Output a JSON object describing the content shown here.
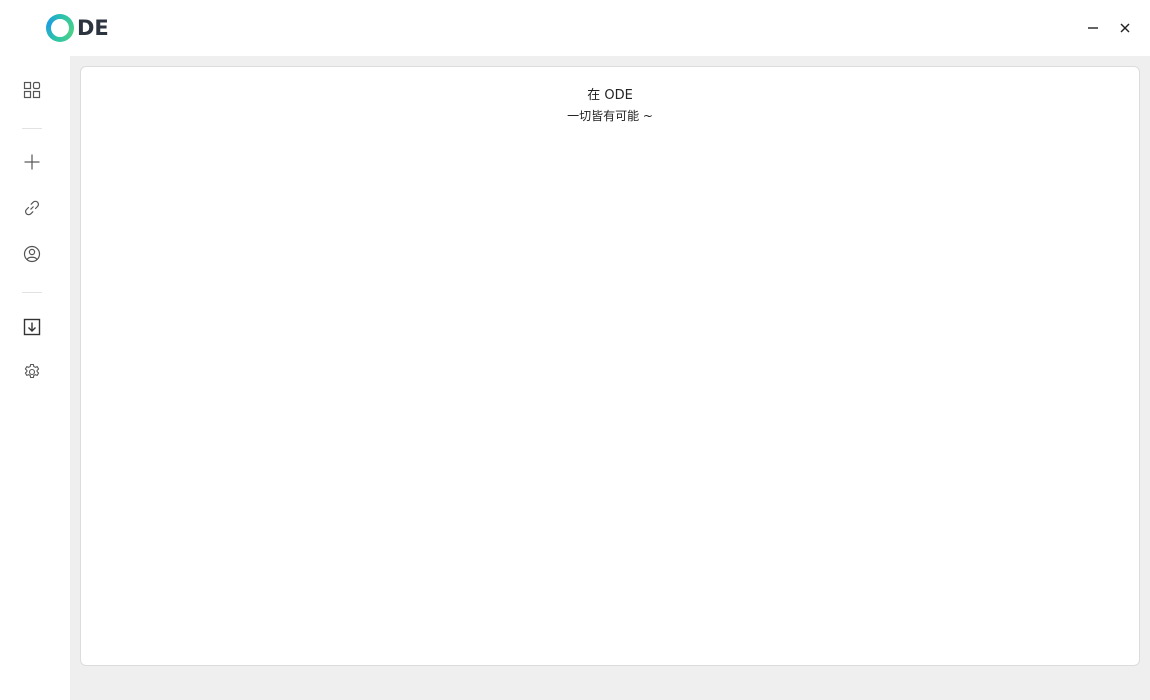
{
  "app": {
    "logo_text": "DE",
    "logo_colors": [
      "#2ec4a5",
      "#1e9fe0"
    ]
  },
  "window_controls": {
    "minimize_icon": "minimize-icon",
    "close_icon": "close-icon"
  },
  "sidebar": {
    "items": [
      {
        "icon": "grid-icon"
      },
      {
        "icon": "plus-icon"
      },
      {
        "icon": "link-icon"
      },
      {
        "icon": "user-circle-icon"
      },
      {
        "icon": "download-icon"
      },
      {
        "icon": "gear-icon"
      }
    ]
  },
  "main": {
    "welcome_line1": "在 ODE",
    "welcome_line2": "一切皆有可能 ~"
  },
  "colors": {
    "background": "#efefef",
    "panel": "#ffffff",
    "icon": "#555555"
  }
}
